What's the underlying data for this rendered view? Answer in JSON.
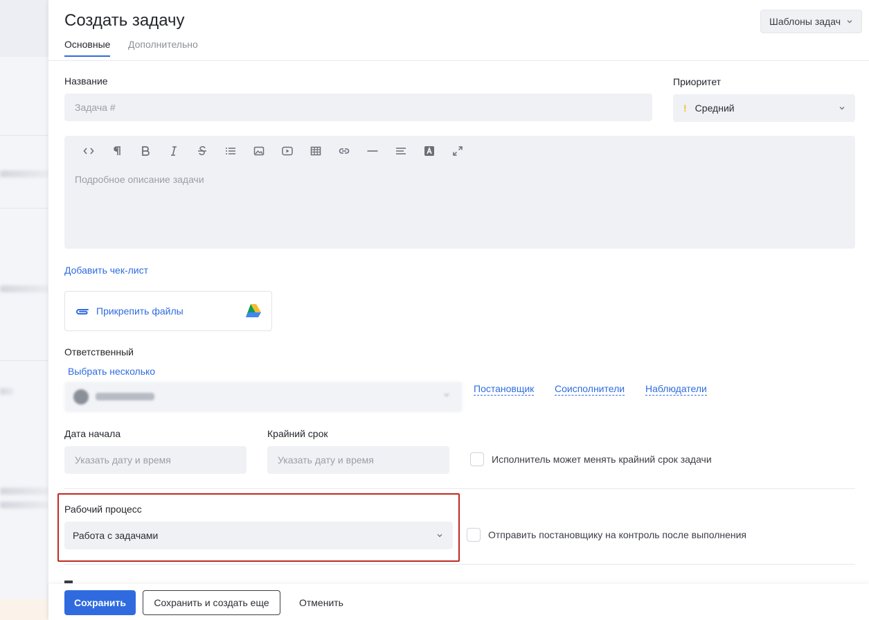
{
  "header": {
    "title": "Создать задачу",
    "tabs": [
      {
        "label": "Основные",
        "active": true
      },
      {
        "label": "Дополнительно",
        "active": false
      }
    ],
    "templates_button": "Шаблоны задач"
  },
  "name": {
    "label": "Название",
    "placeholder": "Задача #"
  },
  "priority": {
    "label": "Приоритет",
    "value": "Средний",
    "indicator": "!"
  },
  "editor": {
    "toolbar": [
      "code-icon",
      "paragraph-icon",
      "bold-icon",
      "italic-icon",
      "strikethrough-icon",
      "list-icon",
      "image-icon",
      "video-icon",
      "table-icon",
      "link-icon",
      "horizontal-rule-icon",
      "align-icon",
      "text-color-icon",
      "fullscreen-icon"
    ],
    "placeholder": "Подробное описание задачи"
  },
  "checklist_link": "Добавить чек-лист",
  "attach": {
    "label": "Прикрепить файлы"
  },
  "assignee": {
    "label": "Ответственный",
    "select_multiple": "Выбрать несколько",
    "links": [
      "Постановщик",
      "Соисполнители",
      "Наблюдатели"
    ]
  },
  "dates": {
    "start_label": "Дата начала",
    "start_placeholder": "Указать дату и время",
    "deadline_label": "Крайний срок",
    "deadline_placeholder": "Указать дату и время",
    "deadline_checkbox": "Исполнитель может менять крайний срок задачи"
  },
  "workflow": {
    "label": "Рабочий процесс",
    "value": "Работа с задачами",
    "control_checkbox": "Отправить постановщику на контроль после выполнения"
  },
  "footer": {
    "save": "Сохранить",
    "save_and_create": "Сохранить и создать еще",
    "cancel": "Отменить"
  },
  "colors": {
    "accent": "#2f6bdf",
    "highlight": "#c0291f",
    "priority_warning": "#f2c12e"
  }
}
